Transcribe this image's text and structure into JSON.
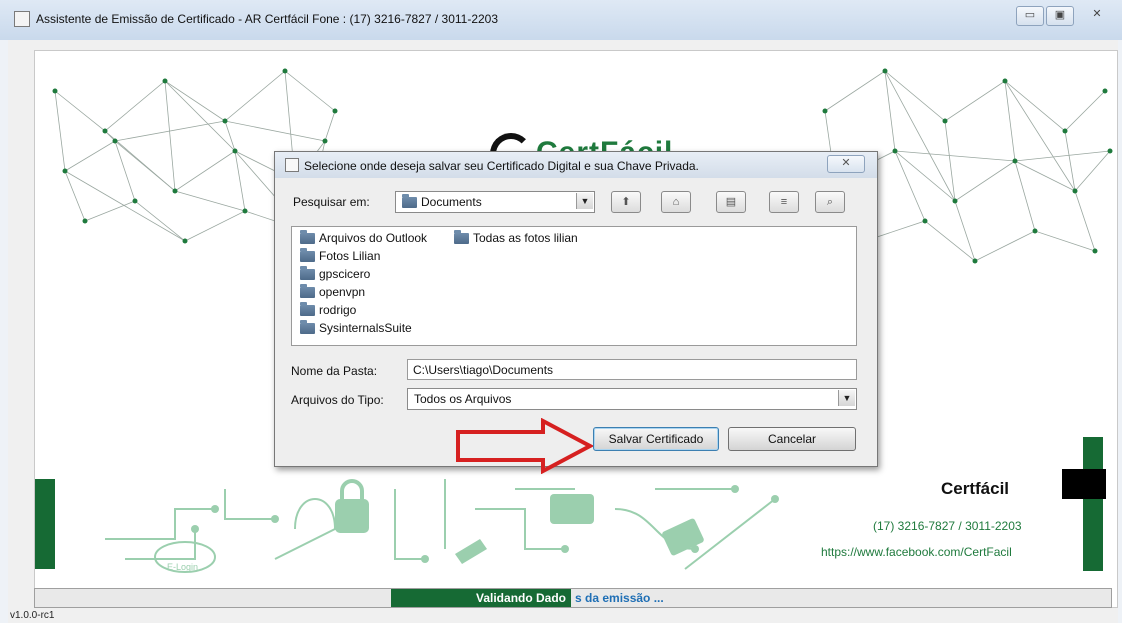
{
  "window": {
    "title": "Assistente de Emissão de Certificado - AR Certfácil Fone : (17) 3216-7827 / 3011-2203",
    "controls": [
      "▭",
      "▣",
      "✕"
    ]
  },
  "brand": {
    "logo_text": "CertFácil",
    "name": "Certfácil",
    "phone": "(17) 3216-7827 / 3011-2203",
    "facebook": "https://www.facebook.com/CertFacil",
    "elogin": "E-Login",
    "green": "#166a34"
  },
  "status": {
    "text_part1": "Validando Dado",
    "text_part2": "s da emissão ...",
    "progress": 0.17
  },
  "version": "v1.0.0-rc1",
  "dialog": {
    "title": "Selecione onde deseja salvar seu Certificado Digital e sua Chave Privada.",
    "close": "✕",
    "lookin_label": "Pesquisar em:",
    "lookin_value": "Documents",
    "toolbar": [
      "up-folder",
      "home",
      "new-folder",
      "list-view",
      "details-view"
    ],
    "files": [
      "Arquivos do Outlook",
      "Todas as fotos lilian",
      "Fotos Lilian",
      "gpscicero",
      "openvpn",
      "rodrigo",
      "SysinternalsSuite"
    ],
    "folder_name_label": "Nome da Pasta:",
    "folder_name_value": "C:\\Users\\tiago\\Documents",
    "filetype_label": "Arquivos do Tipo:",
    "filetype_value": "Todos os Arquivos",
    "save_button": "Salvar Certificado",
    "cancel_button": "Cancelar"
  }
}
